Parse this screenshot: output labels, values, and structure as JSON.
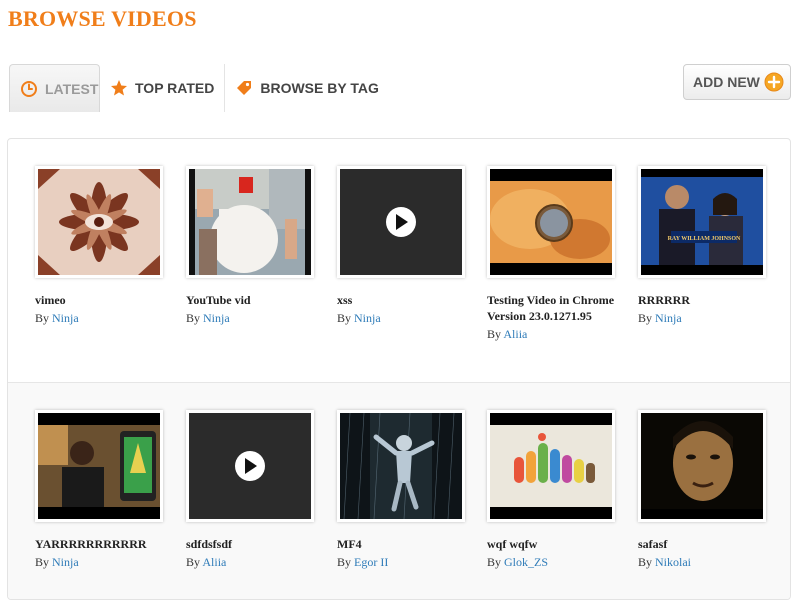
{
  "page": {
    "title": "BROWSE VIDEOS"
  },
  "tabs": [
    {
      "label": "LATEST",
      "icon": "clock-icon"
    },
    {
      "label": "TOP RATED",
      "icon": "star-icon"
    },
    {
      "label": "BROWSE BY TAG",
      "icon": "tag-icon"
    }
  ],
  "add_new": {
    "label": "ADD NEW",
    "icon": "plus-circle-icon"
  },
  "colors": {
    "accent": "#f07e1a",
    "link": "#2e7bb8"
  },
  "by_label": "By",
  "videos": [
    {
      "title": "vimeo",
      "author": "Ninja"
    },
    {
      "title": "YouTube vid",
      "author": "Ninja"
    },
    {
      "title": "xss",
      "author": "Ninja"
    },
    {
      "title": "Testing Video in Chrome Version 23.0.1271.95",
      "author": "Aliia"
    },
    {
      "title": "RRRRRR",
      "author": "Ninja"
    },
    {
      "title": "YARRRRRRRRRRR",
      "author": "Ninja"
    },
    {
      "title": "sdfdsfsdf",
      "author": "Aliia"
    },
    {
      "title": "MF4",
      "author": "Egor II"
    },
    {
      "title": "wqf wqfw",
      "author": "Glok_ZS"
    },
    {
      "title": "safasf",
      "author": "Nikolai"
    }
  ],
  "thumb_caption": "RAY WILLIAM JOHNSON"
}
